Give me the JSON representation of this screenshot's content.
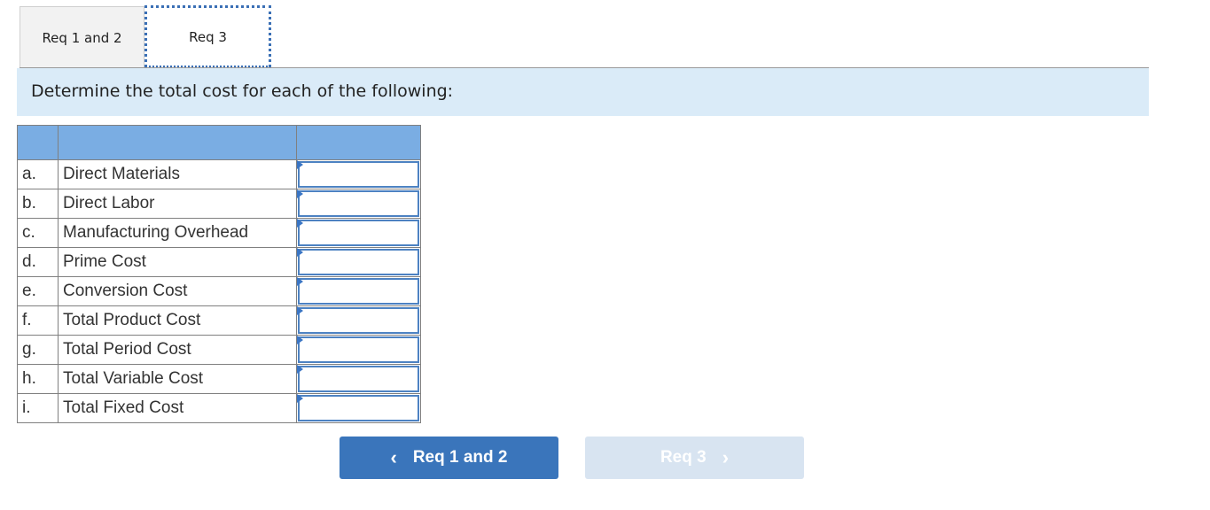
{
  "tabs": [
    {
      "label": "Req 1 and 2",
      "active": false
    },
    {
      "label": "Req 3",
      "active": true
    }
  ],
  "instruction": "Determine the total cost for each of the following:",
  "table": {
    "header": [
      "",
      "",
      ""
    ],
    "rows": [
      {
        "letter": "a.",
        "label": "Direct Materials",
        "value": ""
      },
      {
        "letter": "b.",
        "label": "Direct Labor",
        "value": ""
      },
      {
        "letter": "c.",
        "label": "Manufacturing Overhead",
        "value": ""
      },
      {
        "letter": "d.",
        "label": "Prime Cost",
        "value": ""
      },
      {
        "letter": "e.",
        "label": "Conversion Cost",
        "value": ""
      },
      {
        "letter": "f.",
        "label": "Total Product Cost",
        "value": ""
      },
      {
        "letter": "g.",
        "label": "Total Period Cost",
        "value": ""
      },
      {
        "letter": "h.",
        "label": "Total Variable Cost",
        "value": ""
      },
      {
        "letter": "i.",
        "label": "Total Fixed Cost",
        "value": ""
      }
    ]
  },
  "nav": {
    "prev_label": "Req 1 and 2",
    "prev_icon": "‹",
    "next_label": "Req 3",
    "next_icon": "›"
  },
  "colors": {
    "header_blue": "#7aade3",
    "band_blue": "#daebf8",
    "button_blue": "#3a75bb",
    "button_disabled": "#d8e4f1"
  }
}
